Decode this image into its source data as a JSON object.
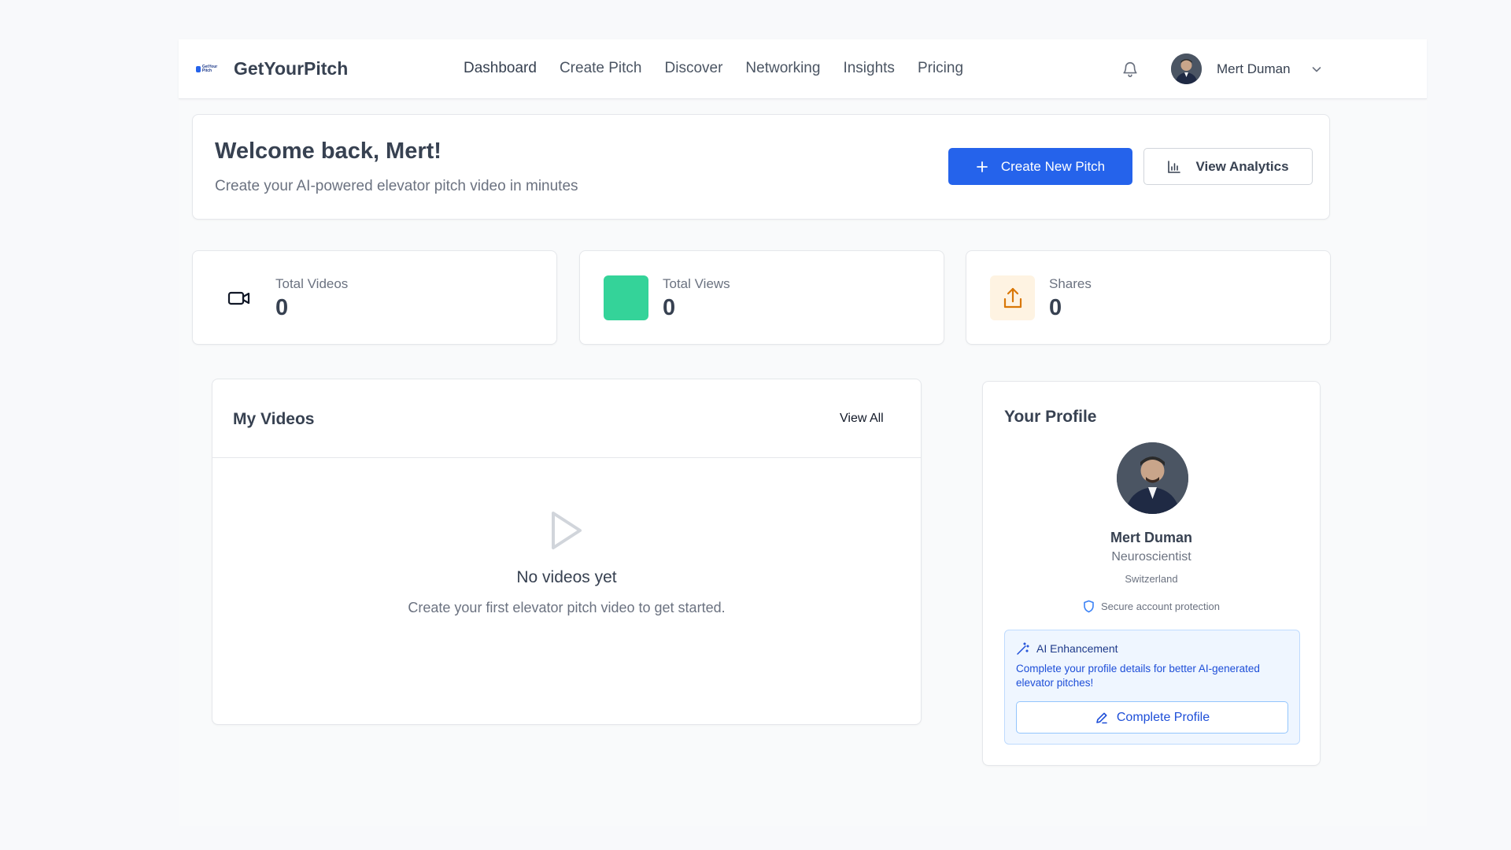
{
  "header": {
    "brand": "GetYourPitch",
    "logo_text": "GetYour Pitch",
    "nav": [
      {
        "label": "Dashboard"
      },
      {
        "label": "Create Pitch"
      },
      {
        "label": "Discover"
      },
      {
        "label": "Networking"
      },
      {
        "label": "Insights"
      },
      {
        "label": "Pricing"
      }
    ],
    "user_name": "Mert Duman",
    "icons": [
      "bell-icon",
      "chevron-down-icon"
    ]
  },
  "welcome": {
    "title": "Welcome back, Mert!",
    "subtitle": "Create your AI-powered elevator pitch video in minutes",
    "create_button": "Create New Pitch",
    "analytics_button": "View Analytics"
  },
  "stats": [
    {
      "label": "Total Videos",
      "value": "0",
      "icon": "video-camera-icon",
      "color": "#111827"
    },
    {
      "label": "Total Views",
      "value": "0",
      "icon": "views-icon",
      "color": "#34d399"
    },
    {
      "label": "Shares",
      "value": "0",
      "icon": "share-icon",
      "color": "#d97706"
    }
  ],
  "videos": {
    "title": "My Videos",
    "view_all": "View All",
    "empty_title": "No videos yet",
    "empty_subtitle": "Create your first elevator pitch video to get started."
  },
  "profile": {
    "title": "Your Profile",
    "name": "Mert Duman",
    "role": "Neuroscientist",
    "location": "Switzerland",
    "secure_text": "Secure account protection",
    "ai_title": "AI Enhancement",
    "ai_desc": "Complete your profile details for better AI-generated elevator pitches!",
    "complete_button": "Complete Profile"
  },
  "colors": {
    "primary": "#2563eb",
    "views_accent": "#34d399",
    "shares_accent": "#d97706",
    "ai_bg": "#eff6ff"
  }
}
